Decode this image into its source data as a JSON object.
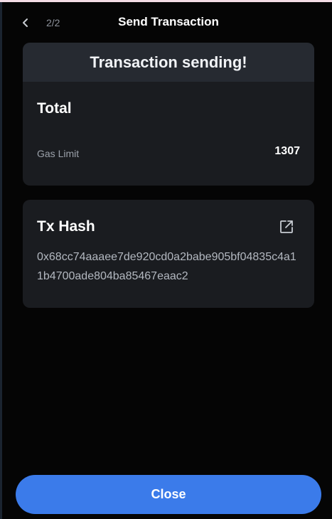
{
  "header": {
    "step": "2/2",
    "title": "Send Transaction"
  },
  "summary": {
    "status": "Transaction sending!",
    "total_label": "Total",
    "gas_limit_label": "Gas Limit",
    "gas_limit_value": "1307"
  },
  "tx": {
    "label": "Tx Hash",
    "hash": "0x68cc74aaaee7de920cd0a2babe905bf04835c4a11b4700ade804ba85467eaac2"
  },
  "footer": {
    "close_label": "Close"
  },
  "colors": {
    "accent": "#3b7bea",
    "card": "#1a1c20",
    "banner": "#262a31",
    "background": "#050505"
  },
  "icons": {
    "back": "chevron-left-icon",
    "open_link": "external-link-icon"
  }
}
